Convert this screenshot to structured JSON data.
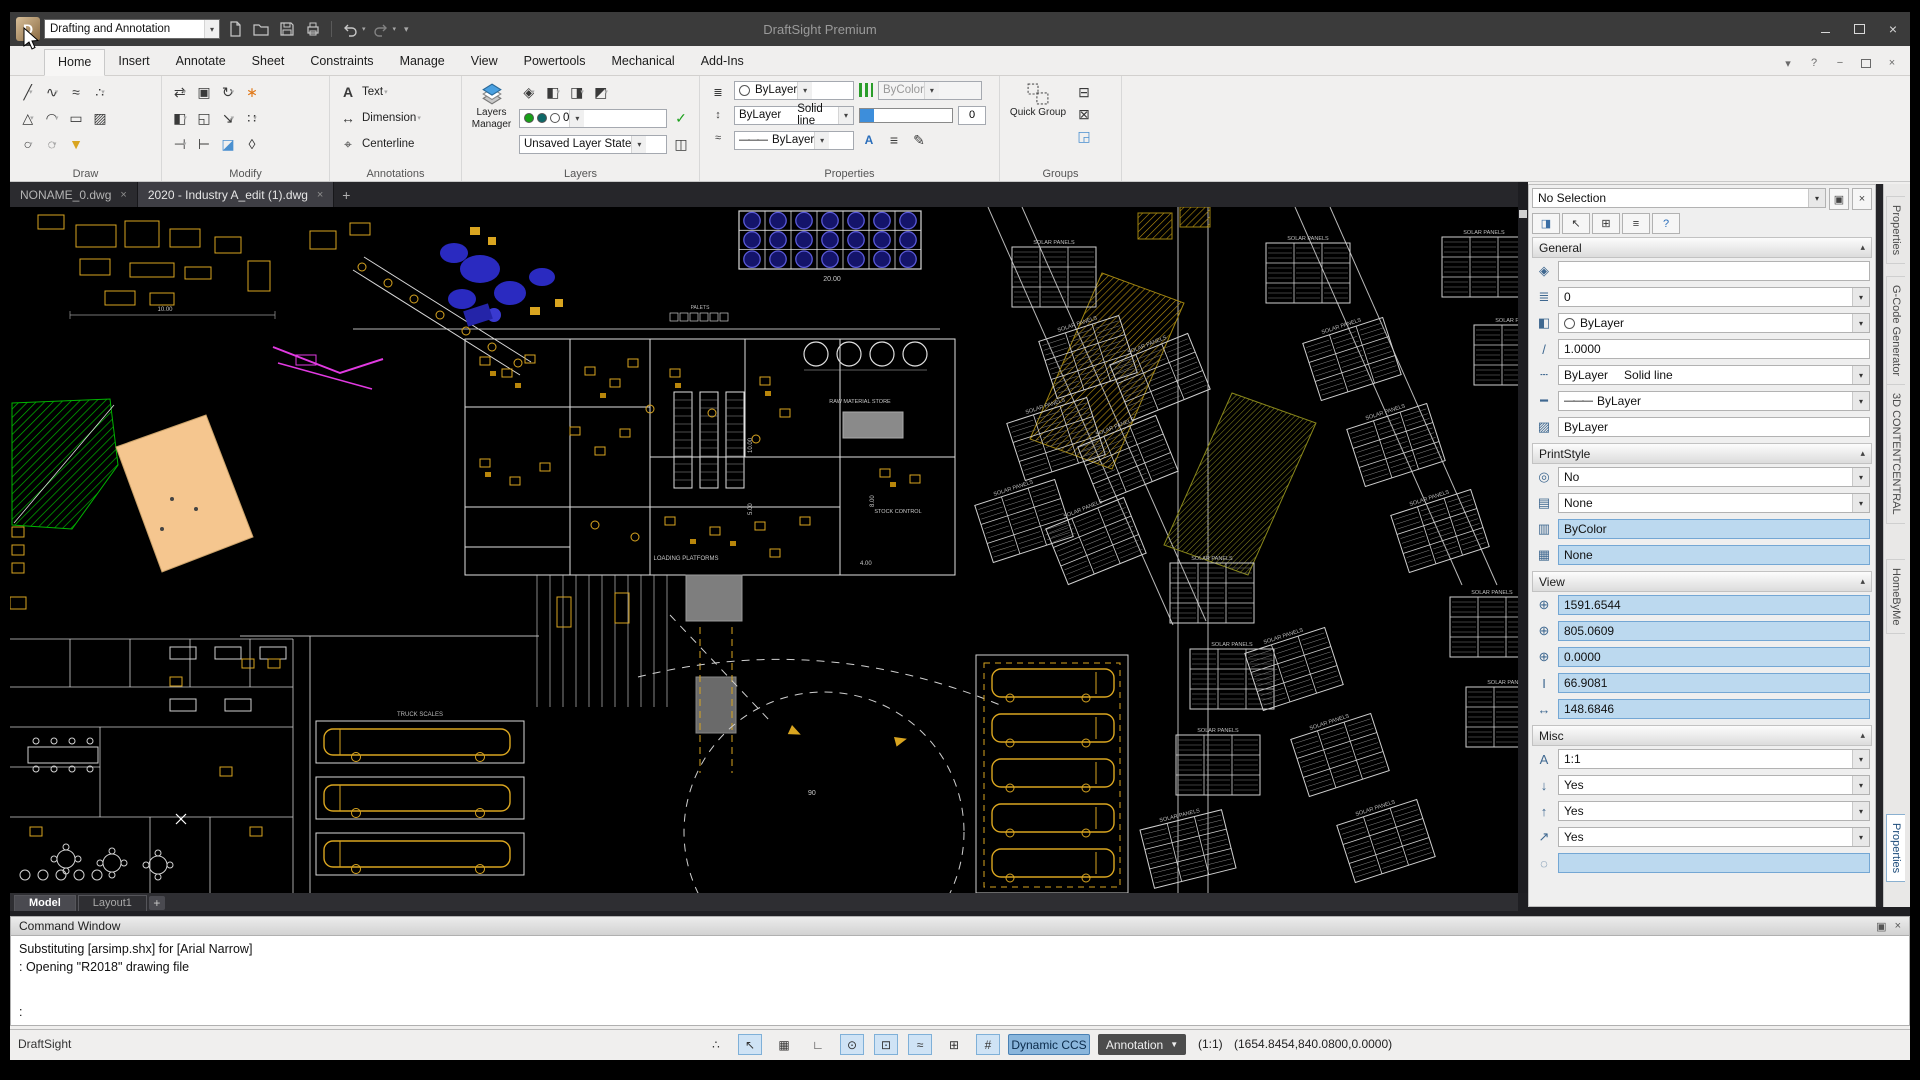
{
  "window": {
    "title": "DraftSight Premium",
    "workspace": "Drafting and Annotation"
  },
  "ribbon": {
    "tabs": [
      {
        "label": "Home",
        "active": true
      },
      {
        "label": "Insert"
      },
      {
        "label": "Annotate"
      },
      {
        "label": "Sheet"
      },
      {
        "label": "Constraints"
      },
      {
        "label": "Manage"
      },
      {
        "label": "View"
      },
      {
        "label": "Powertools"
      },
      {
        "label": "Mechanical"
      },
      {
        "label": "Add-Ins"
      }
    ],
    "groups": {
      "draw": {
        "label": "Draw",
        "rows": [
          [
            {
              "name": "line-icon",
              "glyph": "╱",
              "caret": true
            },
            {
              "name": "polyline-icon",
              "glyph": "∿",
              "caret": true
            },
            {
              "name": "spline-icon",
              "glyph": "≈",
              "caret": false
            },
            {
              "name": "point-icon",
              "glyph": "∴",
              "caret": true
            }
          ],
          [
            {
              "name": "polygon-icon",
              "glyph": "△",
              "caret": true
            },
            {
              "name": "arc-icon",
              "glyph": "◠",
              "caret": true
            },
            {
              "name": "rectangle-icon",
              "glyph": "▭",
              "caret": false
            },
            {
              "name": "hatch-icon",
              "glyph": "▨",
              "caret": false
            }
          ],
          [
            {
              "name": "circle-icon",
              "glyph": "○",
              "caret": true
            },
            {
              "name": "ellipse-icon",
              "glyph": "◌",
              "caret": true
            },
            {
              "name": "area-fill-icon",
              "glyph": "▼",
              "caret": false,
              "color": "#d9a520"
            }
          ]
        ]
      },
      "modify": {
        "label": "Modify",
        "rows": [
          [
            {
              "name": "move-icon",
              "glyph": "⇄",
              "caret": true
            },
            {
              "name": "copy-icon",
              "glyph": "▣",
              "caret": false
            },
            {
              "name": "rotate-icon",
              "glyph": "↻",
              "caret": true
            },
            {
              "name": "smart-modify-icon",
              "glyph": "∗",
              "caret": false,
              "color": "#e07818"
            }
          ],
          [
            {
              "name": "mirror-icon",
              "glyph": "◧",
              "caret": true
            },
            {
              "name": "scale-icon",
              "glyph": "◱",
              "caret": false
            },
            {
              "name": "stretch-icon",
              "glyph": "↘",
              "caret": true
            },
            {
              "name": "pattern-icon",
              "glyph": "∷",
              "caret": true
            }
          ],
          [
            {
              "name": "trim-icon",
              "glyph": "⊣",
              "caret": true
            },
            {
              "name": "extend-icon",
              "glyph": "⊢",
              "caret": false
            },
            {
              "name": "erase-icon",
              "glyph": "◪",
              "caret": false,
              "color": "#4a90d0"
            },
            {
              "name": "explode-icon",
              "glyph": "◊",
              "caret": false
            }
          ]
        ]
      },
      "annotations": {
        "label": "Annotations",
        "items": [
          {
            "icon": "text-icon",
            "glyph": "A",
            "label": "Text",
            "caret": true
          },
          {
            "icon": "dimension-icon",
            "glyph": "↔",
            "label": "Dimension",
            "caret": true
          },
          {
            "icon": "centerline-icon",
            "glyph": "⌖",
            "label": "Centerline",
            "caret": false
          }
        ]
      },
      "layers": {
        "label": "Layers",
        "manager_label": "Layers Manager",
        "layer_value": "0",
        "state_value": "Unsaved Layer State",
        "tool_icons": [
          {
            "name": "layer-hide-icon",
            "glyph": "◈"
          },
          {
            "name": "layer-isolate-icon",
            "glyph": "◧"
          },
          {
            "name": "layer-freeze-icon",
            "glyph": "◨"
          },
          {
            "name": "layer-lock-icon",
            "glyph": "◩"
          }
        ]
      },
      "properties": {
        "label": "Properties",
        "line_color": "ByLayer",
        "print_color": "ByColor",
        "line_style": "ByLayer",
        "line_style2": "Solid line",
        "line_weight": "ByLayer",
        "thickness": "0"
      },
      "groups": {
        "label": "Groups",
        "button_label": "Quick Group"
      }
    }
  },
  "doc_tabs": [
    {
      "label": "NONAME_0.dwg"
    },
    {
      "label": "2020 - Industry A_edit (1).dwg",
      "active": true
    }
  ],
  "properties_panel": {
    "selection": "No Selection",
    "header_icons": [
      {
        "name": "filter-icon",
        "glyph": "◨",
        "color": "#3a6ea5"
      },
      {
        "name": "select-icon",
        "glyph": "↖",
        "color": "#333"
      },
      {
        "name": "quick-select-icon",
        "glyph": "⊞",
        "color": "#333"
      },
      {
        "name": "copy-settings-icon",
        "glyph": "≡",
        "color": "#333"
      },
      {
        "name": "help-icon",
        "glyph": "?",
        "color": "#2a6ebb"
      }
    ],
    "sections": [
      {
        "title": "General",
        "rows": [
          {
            "name": "material-field",
            "icon": "material-icon",
            "glyph": "◈",
            "value": "",
            "type": "input"
          },
          {
            "name": "layer-field",
            "icon": "layer-icon",
            "glyph": "≣",
            "value": "0",
            "type": "select"
          },
          {
            "name": "line-color-field",
            "icon": "line-color-icon",
            "glyph": "◧",
            "value": "ByLayer",
            "type": "select",
            "swatch": true
          },
          {
            "name": "line-scale-field",
            "icon": "line-scale-icon",
            "glyph": "/",
            "value": "1.0000",
            "type": "input"
          },
          {
            "name": "line-style-field",
            "icon": "line-style-icon",
            "glyph": "┄",
            "value": "ByLayer",
            "value2": "Solid line",
            "type": "select"
          },
          {
            "name": "line-weight-field",
            "icon": "line-weight-icon",
            "glyph": "━",
            "value": "ByLayer",
            "type": "select",
            "dash": true
          },
          {
            "name": "transparency-field",
            "icon": "transparency-icon",
            "glyph": "▨",
            "value": "ByLayer",
            "type": "input"
          }
        ]
      },
      {
        "title": "PrintStyle",
        "rows": [
          {
            "name": "print-style-field",
            "icon": "print-style-icon",
            "glyph": "◎",
            "value": "No",
            "type": "select"
          },
          {
            "name": "print-style-table-field",
            "icon": "print-table-icon",
            "glyph": "▤",
            "value": "None",
            "type": "select"
          },
          {
            "name": "print-color-field",
            "icon": "print-color-icon",
            "glyph": "▥",
            "value": "ByColor",
            "type": "input",
            "highlight": true
          },
          {
            "name": "print-pen-field",
            "icon": "print-pen-icon",
            "glyph": "▦",
            "value": "None",
            "type": "input",
            "highlight": true
          }
        ]
      },
      {
        "title": "View",
        "rows": [
          {
            "name": "center-x-field",
            "icon": "center-x-icon",
            "glyph": "⊕",
            "value": "1591.6544",
            "type": "input",
            "highlight": true
          },
          {
            "name": "center-y-field",
            "icon": "center-y-icon",
            "glyph": "⊕",
            "value": "805.0609",
            "type": "input",
            "highlight": true
          },
          {
            "name": "center-z-field",
            "icon": "center-z-icon",
            "glyph": "⊕",
            "value": "0.0000",
            "type": "input",
            "highlight": true
          },
          {
            "name": "height-field",
            "icon": "height-icon",
            "glyph": "I",
            "value": "66.9081",
            "type": "input",
            "highlight": true
          },
          {
            "name": "width-field",
            "icon": "width-icon",
            "glyph": "↔",
            "value": "148.6846",
            "type": "input",
            "highlight": true
          }
        ]
      },
      {
        "title": "Misc",
        "rows": [
          {
            "name": "annotation-scale-field",
            "icon": "annotation-scale-icon",
            "glyph": "A",
            "value": "1:1",
            "type": "select"
          },
          {
            "name": "ucs-follow-field",
            "icon": "ucs-follow-icon",
            "glyph": "↓",
            "value": "Yes",
            "type": "select"
          },
          {
            "name": "ucs-icon-field",
            "icon": "ucs-icon",
            "glyph": "↑",
            "value": "Yes",
            "type": "select"
          },
          {
            "name": "viewport-field",
            "icon": "viewport-icon",
            "glyph": "↗",
            "value": "Yes",
            "type": "select"
          },
          {
            "name": "visual-style-field",
            "icon": "visual-style-icon",
            "glyph": "◌",
            "value": "",
            "type": "input",
            "highlight": true
          }
        ]
      }
    ]
  },
  "side_tabs": [
    {
      "label": "Properties"
    },
    {
      "label": "G-Code Generator"
    },
    {
      "label": "3D CONTENTCENTRAL"
    },
    {
      "label": "HomeByMe"
    },
    {
      "label": "Properties",
      "active": true
    }
  ],
  "sheet_tabs": [
    {
      "label": "Model",
      "active": true
    },
    {
      "label": "Layout1"
    }
  ],
  "command_window": {
    "title": "Command Window",
    "lines": [
      "Substituting [arsimp.shx] for [Arial Narrow]",
      ": Opening \"R2018\" drawing file"
    ],
    "prompt": ":"
  },
  "status_bar": {
    "app": "DraftSight",
    "icons": [
      {
        "name": "snap-settings-icon",
        "glyph": "∴",
        "active": false
      },
      {
        "name": "pointer-icon",
        "glyph": "↖",
        "active": true
      },
      {
        "name": "grid-icon",
        "glyph": "▦",
        "active": false
      },
      {
        "name": "ortho-icon",
        "glyph": "∟",
        "active": false
      },
      {
        "name": "polar-icon",
        "glyph": "⊙",
        "active": true
      },
      {
        "name": "esnap-icon",
        "glyph": "⊡",
        "active": true
      },
      {
        "name": "etrack-icon",
        "glyph": "≈",
        "active": true
      },
      {
        "name": "dynamic-input-icon",
        "glyph": "⊞",
        "active": false
      },
      {
        "name": "annotation-monitor-icon",
        "glyph": "#",
        "active": true
      }
    ],
    "dynamic_ccs": "Dynamic CCS",
    "annotation": "Annotation",
    "scale": "(1:1)",
    "coords": "(1654.8454,840.0800,0.0000)"
  },
  "canvas": {
    "solar_label": "SOLAR PANELS",
    "fan_dim": "20.00",
    "palets_label": "PALETS",
    "truck_label": "TRUCK SCALES",
    "loading_label": "LOADING PLATFORMS",
    "raw_label": "RAW MATERIAL STORE",
    "stock_label": "STOCK CONTROL",
    "dims": [
      "10.00",
      "5.00",
      "8.00",
      "4.00"
    ],
    "angle_label": "90"
  }
}
